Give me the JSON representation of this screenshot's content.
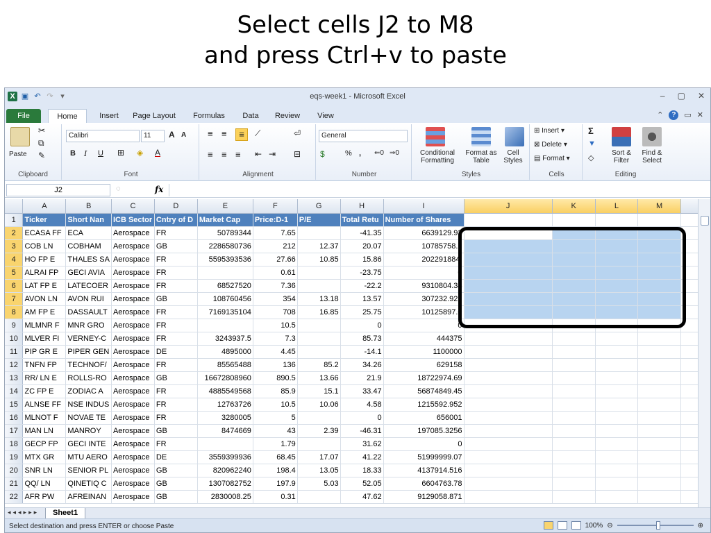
{
  "slide": {
    "title_line1": "Select cells J2 to M8",
    "title_line2": "and press Ctrl+v to paste"
  },
  "window": {
    "title": "eqs-week1 - Microsoft Excel",
    "controls": [
      "–",
      "▢",
      "✕"
    ]
  },
  "tabs": [
    "File",
    "Home",
    "Insert",
    "Page Layout",
    "Formulas",
    "Data",
    "Review",
    "View"
  ],
  "ribbon": {
    "clipboard": {
      "label": "Clipboard",
      "paste": "Paste"
    },
    "font": {
      "label": "Font",
      "name": "Calibri",
      "size": "11",
      "bold": "B",
      "italic": "I",
      "underline": "U",
      "grow": "A",
      "shrink": "A"
    },
    "alignment": {
      "label": "Alignment"
    },
    "number": {
      "label": "Number",
      "format": "General",
      "percent": "%",
      "comma": ","
    },
    "styles": {
      "label": "Styles",
      "conditional": "Conditional Formatting",
      "as_table": "Format as Table",
      "cell_styles": "Cell Styles"
    },
    "cells": {
      "label": "Cells",
      "insert": "Insert",
      "delete": "Delete",
      "format": "Format"
    },
    "editing": {
      "label": "Editing",
      "sort": "Sort & Filter",
      "find": "Find & Select",
      "sigma": "Σ"
    }
  },
  "formula_bar": {
    "name_box": "J2",
    "fx": "fx",
    "value": ""
  },
  "grid": {
    "columns": [
      "A",
      "B",
      "C",
      "D",
      "E",
      "F",
      "G",
      "H",
      "I",
      "J",
      "K",
      "L",
      "M"
    ],
    "header_row": [
      "Ticker",
      "Short Nan",
      "ICB Sector",
      "Cntry of D",
      "Market Cap",
      "Price:D-1",
      "P/E",
      "Total Retu",
      "Number of Shares"
    ],
    "rows": [
      [
        "ECASA FF",
        "ECA",
        "Aerospace",
        "FR",
        "50789344",
        "7.65",
        "",
        "-41.35",
        "6639129.93"
      ],
      [
        "COB LN",
        "COBHAM",
        "Aerospace",
        "GB",
        "2286580736",
        "212",
        "12.37",
        "20.07",
        "10785758.1"
      ],
      [
        "HO FP E",
        "THALES SA",
        "Aerospace",
        "FR",
        "5595393536",
        "27.66",
        "10.85",
        "15.86",
        "202291884."
      ],
      [
        "ALRAI FP",
        "GECI AVIA",
        "Aerospace",
        "FR",
        "",
        "0.61",
        "",
        "-23.75",
        "0"
      ],
      [
        "LAT FP E",
        "LATECOER",
        "Aerospace",
        "FR",
        "68527520",
        "7.36",
        "",
        "-22.2",
        "9310804.34"
      ],
      [
        "AVON LN",
        "AVON RUI",
        "Aerospace",
        "GB",
        "108760456",
        "354",
        "13.18",
        "13.57",
        "307232.926"
      ],
      [
        "AM FP E",
        "DASSAULT",
        "Aerospace",
        "FR",
        "7169135104",
        "708",
        "16.85",
        "25.75",
        "10125897.0"
      ],
      [
        "MLMNR F",
        "MNR GRO",
        "Aerospace",
        "FR",
        "",
        "10.5",
        "",
        "0",
        "0"
      ],
      [
        "MLVER FI",
        "VERNEY-C",
        "Aerospace",
        "FR",
        "3243937.5",
        "7.3",
        "",
        "85.73",
        "444375"
      ],
      [
        "PIP GR E",
        "PIPER GEN",
        "Aerospace",
        "DE",
        "4895000",
        "4.45",
        "",
        "-14.1",
        "1100000"
      ],
      [
        "TNFN FP",
        "TECHNOF/",
        "Aerospace",
        "FR",
        "85565488",
        "136",
        "85.2",
        "34.26",
        "629158"
      ],
      [
        "RR/ LN E",
        "ROLLS-RO",
        "Aerospace",
        "GB",
        "16672808960",
        "890.5",
        "13.66",
        "21.9",
        "18722974.69"
      ],
      [
        "ZC FP E",
        "ZODIAC A",
        "Aerospace",
        "FR",
        "4885549568",
        "85.9",
        "15.1",
        "33.47",
        "56874849.45"
      ],
      [
        "ALNSE FF",
        "NSE INDUS",
        "Aerospace",
        "FR",
        "12763726",
        "10.5",
        "10.06",
        "4.58",
        "1215592.952"
      ],
      [
        "MLNOT F",
        "NOVAE TE",
        "Aerospace",
        "FR",
        "3280005",
        "5",
        "",
        "0",
        "656001"
      ],
      [
        "MAN LN",
        "MANROY",
        "Aerospace",
        "GB",
        "8474669",
        "43",
        "2.39",
        "-46.31",
        "197085.3256"
      ],
      [
        "GECP FP",
        "GECI INTE",
        "Aerospace",
        "FR",
        "",
        "1.79",
        "",
        "31.62",
        "0"
      ],
      [
        "MTX GR",
        "MTU AERO",
        "Aerospace",
        "DE",
        "3559399936",
        "68.45",
        "17.07",
        "41.22",
        "51999999.07"
      ],
      [
        "SNR LN",
        "SENIOR PL",
        "Aerospace",
        "GB",
        "820962240",
        "198.4",
        "13.05",
        "18.33",
        "4137914.516"
      ],
      [
        "QQ/ LN",
        "QINETIQ C",
        "Aerospace",
        "GB",
        "1307082752",
        "197.9",
        "5.03",
        "52.05",
        "6604763.78"
      ],
      [
        "AFR PW",
        "AFREINAN",
        "Aerospace",
        "GB",
        "2830008.25",
        "0.31",
        "",
        "47.62",
        "9129058.871"
      ]
    ]
  },
  "sheet": {
    "tab": "Sheet1"
  },
  "status": {
    "message": "Select destination and press ENTER or choose Paste",
    "zoom": "100%"
  }
}
